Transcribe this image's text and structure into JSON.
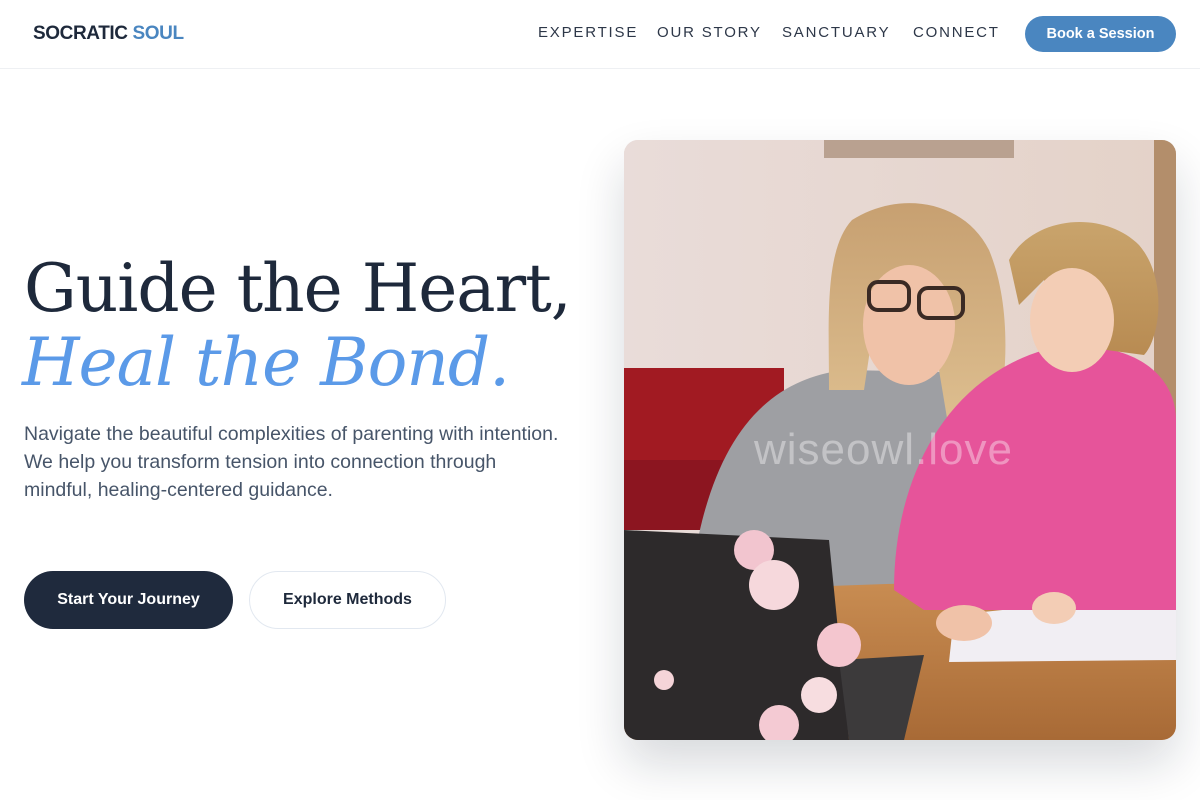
{
  "header": {
    "brand_primary": "SOCRATIC",
    "brand_accent": "SOUL",
    "nav": [
      {
        "label": "EXPERTISE"
      },
      {
        "label": "OUR STORY"
      },
      {
        "label": "SANCTUARY"
      },
      {
        "label": "CONNECT"
      }
    ],
    "cta_label": "Book a Session"
  },
  "hero": {
    "headline": "Guide the Heart,",
    "headline_accent": "Heal the Bond.",
    "lead": "Navigate the beautiful complexities of parenting with intention. We help you transform tension into connection through mindful, healing-centered guidance.",
    "primary_button": "Start Your Journey",
    "secondary_button": "Explore Methods",
    "image_watermark": "wiseowl.love"
  },
  "colors": {
    "brand_accent": "#4a86c0",
    "headline": "#1e293b",
    "headline_accent": "#5b9ae8",
    "primary_button_bg": "#1f2a3d",
    "body_text": "#475569"
  },
  "icons": {
    "hero_photo": "mother-and-child-at-laptop-photo"
  }
}
